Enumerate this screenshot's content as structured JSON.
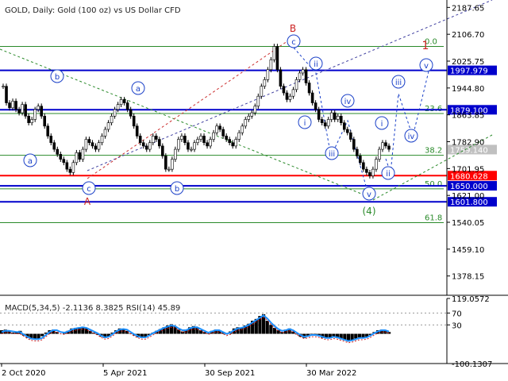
{
  "chart_data": [
    {
      "type": "line",
      "title": "GOLD, Daily:  Gold (100 oz) vs US Dollar CFD",
      "subtype": "candlestick with Elliott wave annotations",
      "x_ticks": [
        "2 Oct 2020",
        "5 Apr 2021",
        "30 Sep 2021",
        "30 Mar 2022"
      ],
      "y_ticks": [
        2187.65,
        2106.7,
        2025.75,
        1944.8,
        1863.85,
        1782.9,
        1701.95,
        1621.0,
        1540.05,
        1459.1,
        1378.15
      ],
      "ylim": [
        1320,
        2210
      ],
      "current_price": 1759.14,
      "levels": [
        {
          "label": "1997.979",
          "value": 1997.979,
          "color": "#0000cc"
        },
        {
          "label": "1879.100",
          "value": 1879.1,
          "color": "#0000cc"
        },
        {
          "label": "1759.140",
          "value": 1759.14,
          "color": "#c0c0c0"
        },
        {
          "label": "1680.628",
          "value": 1680.628,
          "color": "#ff0000"
        },
        {
          "label": "1650.000",
          "value": 1650.0,
          "color": "#0000cc"
        },
        {
          "label": "1601.800",
          "value": 1601.8,
          "color": "#0000cc"
        }
      ],
      "fib_levels": [
        {
          "label": "0.0",
          "value": 2070
        },
        {
          "label": "23.6",
          "value": 1868
        },
        {
          "label": "38.2",
          "value": 1742
        },
        {
          "label": "50.0",
          "value": 1641
        },
        {
          "label": "61.8",
          "value": 1539
        }
      ],
      "wave_labels": {
        "circled": [
          "a",
          "b",
          "c",
          "a",
          "b",
          "c",
          "i",
          "ii",
          "iii",
          "iv",
          "v",
          "i",
          "ii",
          "iii",
          "iv",
          "v"
        ],
        "letters": [
          "A",
          "B"
        ],
        "numbers": [
          "1",
          "(4)"
        ]
      },
      "series": [
        {
          "values": [
            1950,
            1900,
            1885,
            1905,
            1880,
            1870,
            1895,
            1860,
            1840,
            1850,
            1880,
            1890,
            1860,
            1830,
            1800,
            1780,
            1760,
            1745,
            1730,
            1720,
            1700,
            1690,
            1720,
            1750,
            1730,
            1760,
            1790,
            1780,
            1770,
            1760,
            1780,
            1800,
            1820,
            1840,
            1860,
            1880,
            1895,
            1910,
            1900,
            1880,
            1860,
            1830,
            1800,
            1780,
            1770,
            1760,
            1780,
            1800,
            1790,
            1770,
            1740,
            1700,
            1700,
            1730,
            1760,
            1790,
            1800,
            1780,
            1760,
            1760,
            1780,
            1790,
            1800,
            1780,
            1770,
            1790,
            1810,
            1830,
            1820,
            1800,
            1790,
            1780,
            1770,
            1790,
            1810,
            1830,
            1850,
            1860,
            1870,
            1890,
            1920,
            1950,
            1970,
            2000,
            2030,
            2070,
            2000,
            1950,
            1930,
            1910,
            1920,
            1940,
            1970,
            1990,
            2000,
            1960,
            1930,
            1900,
            1880,
            1850,
            1840,
            1830,
            1850,
            1870,
            1850,
            1860,
            1840,
            1820,
            1810,
            1790,
            1760,
            1740,
            1720,
            1700,
            1690,
            1680,
            1700,
            1730,
            1760,
            1780,
            1770,
            1760
          ]
        }
      ]
    },
    {
      "type": "line",
      "title": "MACD(5,34,5) -2.1136 8.3825 RSI(14) 45.89",
      "y_ticks": [
        119.0572,
        70.0,
        30.0,
        -100.1307
      ],
      "ylim": [
        -100.1307,
        119.0572
      ],
      "series": [
        {
          "values": [
            12,
            14,
            8,
            4,
            6,
            10,
            -6,
            -14,
            -18,
            -20,
            -16,
            -8,
            4,
            12,
            14,
            6,
            0,
            4,
            10,
            18,
            20,
            22,
            24,
            18,
            10,
            4,
            -4,
            -10,
            -14,
            -8,
            4,
            12,
            18,
            16,
            10,
            2,
            -6,
            -12,
            -14,
            -10,
            -4,
            4,
            10,
            16,
            22,
            28,
            32,
            24,
            14,
            8,
            14,
            22,
            26,
            20,
            12,
            6,
            2,
            10,
            14,
            10,
            4,
            -2,
            8,
            18,
            22,
            20,
            28,
            34,
            44,
            50,
            60,
            66,
            44,
            30,
            20,
            12,
            6,
            14,
            18,
            8,
            -2,
            -10,
            -14,
            -6,
            -2,
            -4,
            -8,
            -14,
            -16,
            -12,
            -8,
            -14,
            -18,
            -22,
            -26,
            -20,
            -16,
            -12,
            -14,
            -10,
            -4,
            6,
            12,
            14,
            10,
            6
          ]
        },
        {
          "values": [
            6,
            10,
            10,
            8,
            6,
            6,
            -2,
            -10,
            -16,
            -18,
            -18,
            -14,
            -4,
            6,
            12,
            12,
            6,
            4,
            8,
            14,
            18,
            20,
            22,
            20,
            14,
            8,
            2,
            -6,
            -12,
            -10,
            -2,
            8,
            14,
            16,
            14,
            6,
            -2,
            -8,
            -12,
            -12,
            -6,
            2,
            8,
            14,
            20,
            24,
            28,
            26,
            18,
            12,
            12,
            18,
            22,
            22,
            16,
            10,
            4,
            8,
            12,
            12,
            6,
            0,
            4,
            12,
            18,
            20,
            24,
            30,
            38,
            46,
            54,
            62,
            52,
            38,
            26,
            16,
            10,
            12,
            16,
            12,
            4,
            -4,
            -10,
            -8,
            -4,
            -4,
            -6,
            -10,
            -14,
            -14,
            -10,
            -12,
            -16,
            -20,
            -24,
            -22,
            -18,
            -14,
            -14,
            -12,
            -6,
            2,
            8,
            12,
            12,
            8
          ]
        }
      ]
    }
  ],
  "colors": {
    "up_candle": "#000000",
    "blue_line": "#0000cc",
    "red_line": "#ff0000",
    "fib_green": "#2a8a2a",
    "wave_red": "#cc2222",
    "wave_blue": "#1a40c8"
  }
}
